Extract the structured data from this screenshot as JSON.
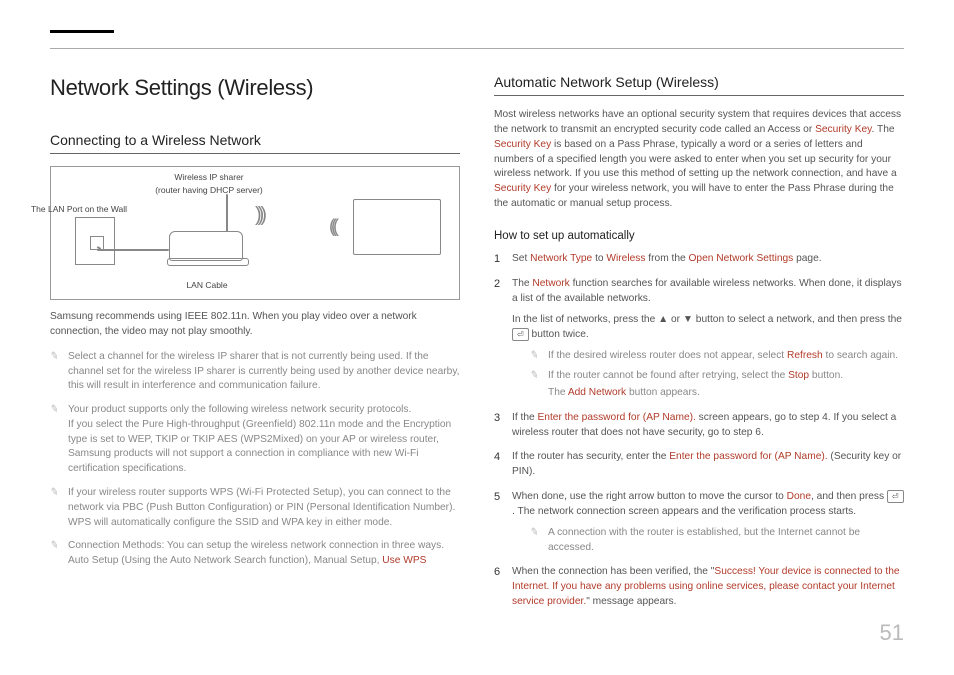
{
  "pageNumber": "51",
  "left": {
    "h1": "Network Settings (Wireless)",
    "h2": "Connecting to a Wireless Network",
    "diagram": {
      "sharer_top": "Wireless IP sharer",
      "sharer_bot": "(router having DHCP server)",
      "wall": "The LAN Port on the Wall",
      "cable": "LAN Cable"
    },
    "intro": "Samsung recommends using IEEE 802.11n. When you play video over a network connection, the video may not play smoothly.",
    "b1": "Select a channel for the wireless IP sharer that is not currently being used. If the channel set for the wireless IP sharer is currently being used by another device nearby, this will result in interference and communication failure.",
    "b2a": "Your product supports only the following wireless network security protocols.",
    "b2b": "If you select the Pure High-throughput (Greenfield) 802.11n mode and the Encryption type is set to WEP, TKIP or TKIP AES (WPS2Mixed) on your AP or wireless router, Samsung products will not support a connection in compliance with new Wi-Fi certification specifications.",
    "b3": "If your wireless router supports WPS (Wi-Fi Protected Setup), you can connect to the network via PBC (Push Button Configuration) or PIN (Personal Identification Number). WPS will automatically configure the SSID and WPA key in either mode.",
    "b4a": "Connection Methods: You can setup the wireless network connection in three ways.",
    "b4b": "Auto Setup (Using the Auto Network Search function), Manual Setup, ",
    "b4c": "Use WPS"
  },
  "right": {
    "h2": "Automatic Network Setup (Wireless)",
    "intro_a": "Most wireless networks have an optional security system that requires devices that access the network to transmit an encrypted security code called an Access or ",
    "k_seckey": "Security Key",
    "intro_b": ". The ",
    "intro_c": " is based on a Pass Phrase, typically a word or a series of letters and numbers of a specified length you were asked to enter when you set up security for your wireless network. If you use this method of setting up the network connection, and have a ",
    "intro_d": " for your wireless network, you will have to enter the Pass Phrase during the the automatic or manual setup process.",
    "h3": "How to set up automatically",
    "s1a": "Set ",
    "k_ntype": "Network Type",
    "s1b": " to ",
    "k_wireless": "Wireless",
    "s1c": " from the ",
    "k_open": "Open Network Settings",
    "s1d": " page.",
    "s2a": "The ",
    "k_network": "Network",
    "s2b": " function searches for available wireless networks. When done, it displays a list of the available networks.",
    "s2c": "In the list of networks, press the ▲ or ▼ button to select a network, and then press the ",
    "s2d": " button twice.",
    "s2e_a": "If the desired wireless router does not appear, select ",
    "k_refresh": "Refresh",
    "s2e_b": " to search again.",
    "s2f_a": "If the router cannot be found after retrying, select the ",
    "k_stop": "Stop",
    "s2f_b": " button.",
    "s2g_a": "The ",
    "k_addnet": "Add Network",
    "s2g_b": " button appears.",
    "s3a": "If the ",
    "k_enterpw": "Enter the password for (AP Name).",
    "s3b": " screen appears, go to step 4. If you select a wireless router that does not have security, go to step 6.",
    "s4a": "If the router has security, enter the ",
    "s4b": " (Security key or PIN).",
    "s5a": "When done, use the right arrow button to move the cursor to ",
    "k_done": "Done",
    "s5b": ", and then press ",
    "s5c": ". The network connection screen appears and the verification process starts.",
    "s5note": "A connection with the router is established, but the Internet cannot be accessed.",
    "s6a": "When the connection has been verified, the \"",
    "k_success": "Success! Your device is connected to the Internet. If you have any problems using online services, please contact your Internet service provider.",
    "s6b": "\" message appears.",
    "btn_enter": "⏎"
  }
}
